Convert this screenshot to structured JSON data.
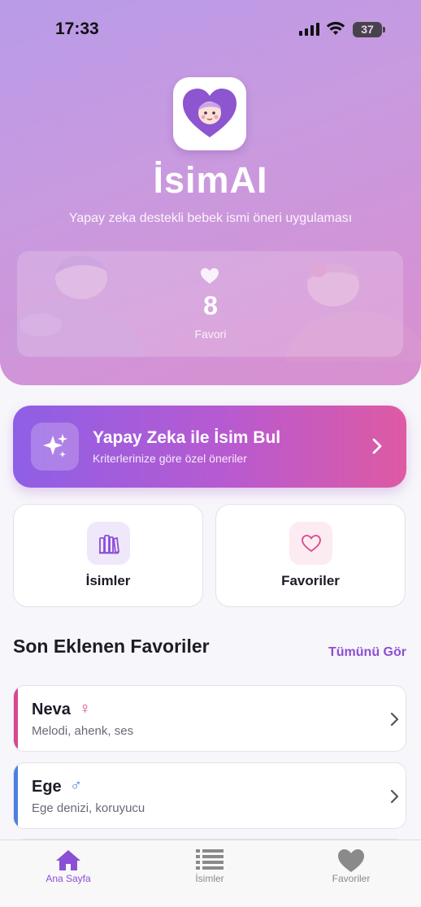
{
  "status_bar": {
    "time": "17:33",
    "battery": "37"
  },
  "hero": {
    "app_title": "İsimAI",
    "app_subtitle": "Yapay zeka destekli bebek ismi öneri uygulaması",
    "favorite_count": "8",
    "favorite_label": "Favori"
  },
  "ai_card": {
    "title": "Yapay Zeka ile İsim Bul",
    "subtitle": "Kriterlerinize göre özel öneriler"
  },
  "tiles": [
    {
      "label": "İsimler",
      "icon": "books-icon"
    },
    {
      "label": "Favoriler",
      "icon": "heart-outline-icon"
    }
  ],
  "recent": {
    "title": "Son Eklenen Favoriler",
    "see_all": "Tümünü Gör",
    "items": [
      {
        "name": "Neva",
        "gender_symbol": "♀",
        "meaning": "Melodi, ahenk, ses",
        "accent": "#d9478f"
      },
      {
        "name": "Ege",
        "gender_symbol": "♂",
        "meaning": "Ege denizi, koruyucu",
        "accent": "#4d7fe0"
      }
    ]
  },
  "tab_bar": [
    {
      "label": "Ana Sayfa",
      "icon": "home-icon",
      "active": true
    },
    {
      "label": "İsimler",
      "icon": "list-icon",
      "active": false
    },
    {
      "label": "Favoriler",
      "icon": "heart-icon",
      "active": false
    }
  ],
  "colors": {
    "accent": "#8b4fd6",
    "female": "#d9478f",
    "male": "#4d7fe0"
  }
}
